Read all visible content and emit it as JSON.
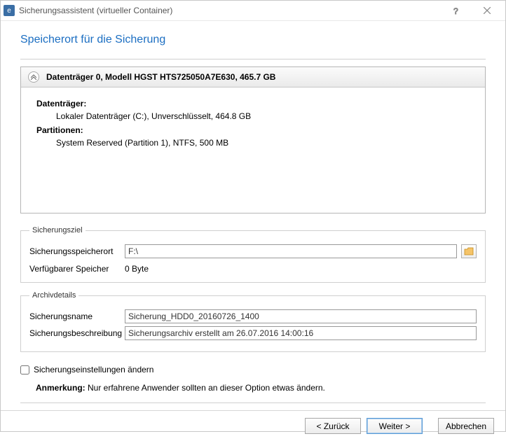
{
  "window": {
    "title": "Sicherungsassistent (virtueller Container)",
    "app_icon_char": "e"
  },
  "page": {
    "heading": "Speicherort für die Sicherung"
  },
  "disk": {
    "header": "Datenträger 0, Modell HGST HTS725050A7E630, 465.7 GB",
    "datentraeger_label": "Datenträger:",
    "datentraeger_value": "Lokaler Datenträger (C:), Unverschlüsselt, 464.8 GB",
    "partitionen_label": "Partitionen:",
    "partitionen_value": "System Reserved (Partition 1), NTFS, 500 MB"
  },
  "target": {
    "legend": "Sicherungsziel",
    "location_label": "Sicherungsspeicherort",
    "location_value": "F:\\",
    "free_label": "Verfügbarer Speicher",
    "free_value": "0 Byte"
  },
  "archive": {
    "legend": "Archivdetails",
    "name_label": "Sicherungsname",
    "name_value": "Sicherung_HDD0_20160726_1400",
    "desc_label": "Sicherungsbeschreibung",
    "desc_value": "Sicherungsarchiv erstellt am 26.07.2016 14:00:16"
  },
  "settings": {
    "change_label": "Sicherungseinstellungen ändern",
    "note_bold": "Anmerkung:",
    "note_text": " Nur erfahrene Anwender sollten an dieser Option etwas ändern."
  },
  "buttons": {
    "back": "< Zurück",
    "next": "Weiter >",
    "cancel": "Abbrechen"
  }
}
